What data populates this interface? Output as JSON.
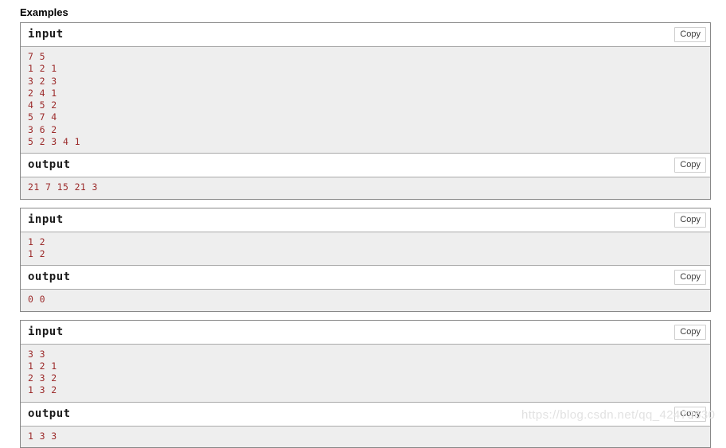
{
  "section": {
    "title": "Examples"
  },
  "labels": {
    "input": "input",
    "output": "output",
    "copy": "Copy"
  },
  "colors": {
    "data_text": "#9c2b2b",
    "body_background": "#eeeeee",
    "block_border": "#888888",
    "watermark": "#e2e2e2"
  },
  "examples": [
    {
      "input_label": "input",
      "input_lines": [
        "7 5",
        "1 2 1",
        "3 2 3",
        "2 4 1",
        "4 5 2",
        "5 7 4",
        "3 6 2",
        "5 2 3 4 1"
      ],
      "output_label": "output",
      "output_lines": [
        "21 7 15 21 3"
      ]
    },
    {
      "input_label": "input",
      "input_lines": [
        "1 2",
        "1 2"
      ],
      "output_label": "output",
      "output_lines": [
        "0 0"
      ]
    },
    {
      "input_label": "input",
      "input_lines": [
        "3 3",
        "1 2 1",
        "2 3 2",
        "1 3 2"
      ],
      "output_label": "output",
      "output_lines": [
        "1 3 3"
      ]
    }
  ],
  "watermark": {
    "text": "https://blog.csdn.net/qq_42479630"
  }
}
